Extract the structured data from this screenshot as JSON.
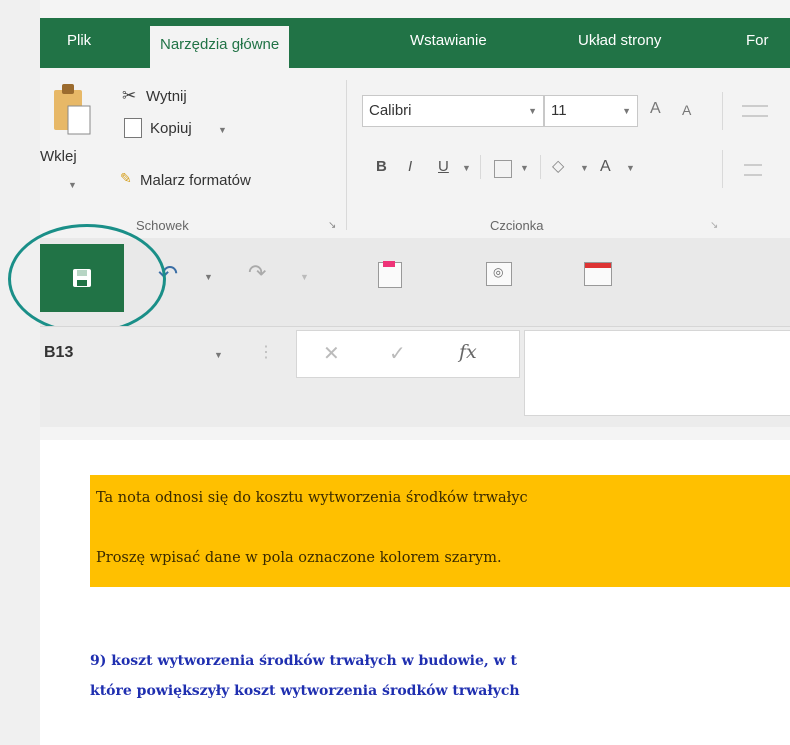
{
  "ribbon_tabs": [
    {
      "label": "Plik"
    },
    {
      "label": "Narzędzia główne"
    },
    {
      "label": "Wstawianie"
    },
    {
      "label": "Układ strony"
    },
    {
      "label": "For"
    }
  ],
  "clipboard": {
    "paste_label": "Wklej",
    "cut_label": "Wytnij",
    "copy_label": "Kopiuj",
    "format_painter_label": "Malarz formatów",
    "group_label": "Schowek"
  },
  "font": {
    "font_name": "Calibri",
    "font_size": "11",
    "bold": "B",
    "italic": "I",
    "underline": "U",
    "font_color_letter": "A",
    "grow_font": "A",
    "shrink_font": "A",
    "group_label": "Czcionka"
  },
  "formula_bar": {
    "name_box": "B13",
    "fx_label": "fx",
    "cancel_symbol": "✕",
    "enter_symbol": "✓",
    "colon_symbol": "⋮"
  },
  "sheet": {
    "note_line1": "Ta nota odnosi się do kosztu wytworzenia środków trwałyc",
    "note_line2": "Proszę wpisać dane w pola oznaczone kolorem szarym.",
    "heading_line1": "9) koszt wytworzenia środków trwałych w budowie, w t",
    "heading_line2": "które powiększyły koszt wytworzenia środków trwałych"
  },
  "colors": {
    "accent": "#217346",
    "note_background": "#ffc000",
    "heading_text": "#1f2fb0",
    "highlight_circle": "#1a8f88"
  }
}
